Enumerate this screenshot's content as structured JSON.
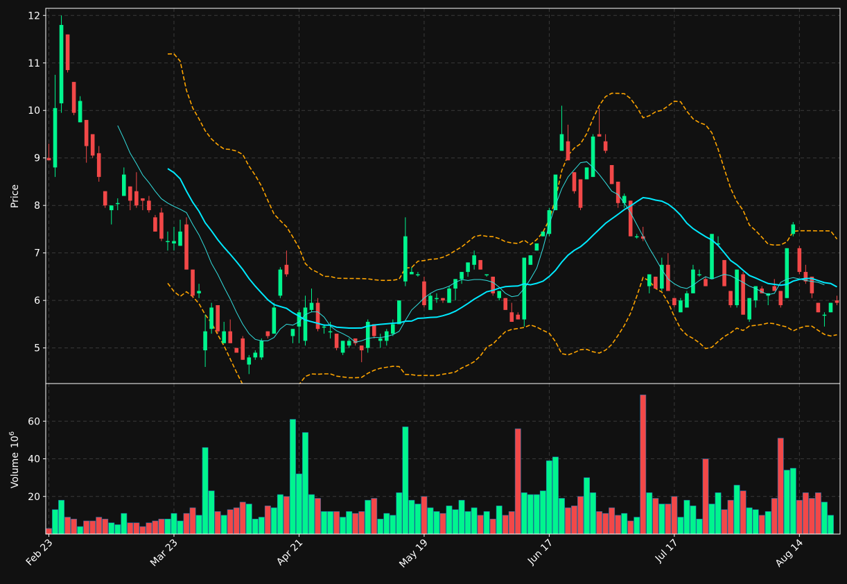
{
  "chart_data": {
    "type": "candlestick",
    "ylabel": "Price",
    "volume_label": "Volume",
    "volume_exponent": "10",
    "volume_exponent_power": "6",
    "price_ylim": [
      4.25,
      12.15
    ],
    "volume_ylim": [
      0,
      80
    ],
    "price_ticks": [
      "5",
      "6",
      "7",
      "8",
      "9",
      "10",
      "11",
      "12"
    ],
    "volume_ticks": [
      "20",
      "40",
      "60"
    ],
    "x_ticks": [
      {
        "index": 0,
        "label": "Feb 23"
      },
      {
        "index": 20,
        "label": "Mar 23"
      },
      {
        "index": 40,
        "label": "Apr 21"
      },
      {
        "index": 60,
        "label": "May 19"
      },
      {
        "index": 80,
        "label": "Jun 17"
      },
      {
        "index": 100,
        "label": "Jul 17"
      },
      {
        "index": 120,
        "label": "Aug 14"
      }
    ],
    "colors": {
      "up": "#00f58e",
      "down": "#f24848",
      "ma_fast": "#32e0e0",
      "ma_slow": "#00eaff",
      "bands": "#ffa500",
      "grid": "#3a3a3a",
      "background": "#111111"
    },
    "ohlc": [
      [
        9.0,
        9.3,
        8.95,
        8.95
      ],
      [
        8.8,
        10.75,
        8.6,
        10.05
      ],
      [
        10.15,
        12.0,
        9.95,
        11.8
      ],
      [
        11.6,
        11.6,
        10.8,
        10.85
      ],
      [
        10.6,
        10.6,
        9.9,
        9.95
      ],
      [
        9.75,
        10.3,
        9.75,
        10.2
      ],
      [
        9.8,
        9.8,
        8.9,
        9.25
      ],
      [
        9.5,
        9.5,
        9.0,
        9.05
      ],
      [
        9.1,
        9.25,
        8.5,
        8.6
      ],
      [
        8.3,
        8.3,
        7.95,
        8.0
      ],
      [
        7.9,
        8.0,
        7.6,
        8.0
      ],
      [
        8.05,
        8.15,
        7.9,
        8.05
      ],
      [
        8.2,
        8.8,
        8.2,
        8.65
      ],
      [
        8.4,
        8.4,
        7.9,
        8.1
      ],
      [
        8.3,
        8.7,
        7.95,
        8.0
      ],
      [
        8.15,
        8.15,
        7.9,
        8.1
      ],
      [
        8.1,
        8.2,
        7.85,
        7.9
      ],
      [
        7.75,
        7.8,
        7.45,
        7.45
      ],
      [
        7.85,
        7.95,
        7.25,
        7.3
      ],
      [
        7.25,
        7.45,
        7.05,
        7.25
      ],
      [
        7.2,
        7.55,
        7.05,
        7.25
      ],
      [
        7.15,
        7.7,
        7.15,
        7.45
      ],
      [
        7.6,
        7.75,
        6.65,
        6.65
      ],
      [
        6.65,
        6.65,
        6.05,
        6.1
      ],
      [
        6.15,
        6.35,
        6.05,
        6.2
      ],
      [
        4.95,
        5.7,
        4.6,
        5.35
      ],
      [
        5.4,
        5.95,
        5.3,
        5.85
      ],
      [
        5.9,
        5.9,
        5.3,
        5.35
      ],
      [
        5.1,
        5.55,
        5.1,
        5.35
      ],
      [
        5.35,
        5.6,
        5.1,
        5.1
      ],
      [
        5.0,
        5.0,
        4.9,
        4.9
      ],
      [
        5.2,
        5.25,
        4.75,
        4.75
      ],
      [
        4.65,
        4.85,
        4.45,
        4.8
      ],
      [
        4.8,
        4.95,
        4.75,
        4.9
      ],
      [
        4.8,
        5.2,
        4.75,
        5.15
      ],
      [
        5.35,
        5.35,
        5.2,
        5.25
      ],
      [
        5.3,
        5.95,
        5.3,
        5.85
      ],
      [
        6.1,
        6.7,
        6.05,
        6.65
      ],
      [
        6.75,
        7.05,
        6.5,
        6.55
      ],
      [
        5.25,
        5.4,
        5.1,
        5.4
      ],
      [
        5.45,
        5.8,
        5.1,
        5.75
      ],
      [
        5.15,
        6.1,
        5.05,
        5.85
      ],
      [
        5.8,
        6.25,
        5.75,
        5.95
      ],
      [
        5.95,
        6.05,
        5.35,
        5.4
      ],
      [
        5.45,
        5.5,
        5.3,
        5.45
      ],
      [
        5.35,
        5.55,
        5.2,
        5.35
      ],
      [
        5.3,
        5.3,
        4.95,
        5.0
      ],
      [
        4.9,
        5.15,
        4.85,
        5.15
      ],
      [
        5.05,
        5.2,
        5.0,
        5.15
      ],
      [
        5.2,
        5.2,
        5.05,
        5.1
      ],
      [
        5.05,
        5.05,
        4.7,
        4.95
      ],
      [
        5.0,
        5.6,
        4.9,
        5.55
      ],
      [
        5.5,
        5.5,
        5.2,
        5.25
      ],
      [
        5.15,
        5.3,
        5.0,
        5.2
      ],
      [
        5.15,
        5.4,
        5.05,
        5.35
      ],
      [
        5.3,
        5.6,
        5.25,
        5.5
      ],
      [
        5.5,
        6.0,
        5.5,
        6.0
      ],
      [
        6.4,
        7.75,
        6.3,
        7.35
      ],
      [
        6.55,
        6.7,
        6.55,
        6.6
      ],
      [
        6.55,
        6.6,
        6.5,
        6.55
      ],
      [
        6.4,
        6.5,
        5.85,
        5.9
      ],
      [
        5.8,
        6.15,
        5.8,
        6.1
      ],
      [
        6.05,
        6.15,
        5.95,
        6.05
      ],
      [
        6.05,
        6.05,
        5.95,
        6.0
      ],
      [
        5.95,
        6.3,
        5.95,
        6.25
      ],
      [
        6.25,
        6.45,
        6.0,
        6.45
      ],
      [
        6.45,
        6.6,
        6.35,
        6.6
      ],
      [
        6.6,
        6.8,
        6.5,
        6.8
      ],
      [
        6.75,
        7.05,
        6.65,
        6.95
      ],
      [
        6.85,
        6.85,
        6.65,
        6.65
      ],
      [
        6.55,
        6.55,
        6.5,
        6.55
      ],
      [
        6.5,
        6.5,
        6.1,
        6.15
      ],
      [
        6.05,
        6.2,
        6.0,
        6.2
      ],
      [
        6.05,
        6.05,
        5.8,
        5.8
      ],
      [
        5.75,
        5.95,
        5.55,
        5.55
      ],
      [
        5.7,
        5.75,
        5.6,
        5.6
      ],
      [
        5.6,
        6.15,
        5.45,
        6.9
      ],
      [
        6.75,
        6.95,
        6.75,
        6.95
      ],
      [
        7.05,
        7.2,
        7.05,
        7.2
      ],
      [
        7.35,
        7.45,
        7.35,
        7.45
      ],
      [
        7.4,
        7.95,
        7.35,
        7.9
      ],
      [
        7.9,
        8.6,
        7.9,
        8.65
      ],
      [
        9.15,
        10.1,
        9.15,
        9.5
      ],
      [
        9.35,
        9.7,
        8.95,
        8.95
      ],
      [
        8.7,
        8.7,
        8.25,
        8.3
      ],
      [
        8.55,
        8.55,
        7.9,
        7.95
      ],
      [
        8.55,
        8.8,
        8.55,
        8.8
      ],
      [
        8.6,
        9.5,
        8.6,
        9.45
      ],
      [
        9.5,
        10.05,
        9.45,
        9.45
      ],
      [
        9.35,
        9.5,
        9.1,
        9.15
      ],
      [
        8.85,
        8.85,
        8.45,
        8.45
      ],
      [
        8.5,
        8.5,
        7.95,
        8.05
      ],
      [
        8.05,
        8.25,
        7.95,
        8.2
      ],
      [
        8.1,
        8.1,
        7.35,
        7.35
      ],
      [
        7.35,
        7.4,
        7.3,
        7.35
      ],
      [
        7.35,
        7.55,
        7.25,
        7.3
      ],
      [
        6.3,
        6.55,
        6.15,
        6.55
      ],
      [
        6.5,
        6.5,
        6.25,
        6.25
      ],
      [
        6.25,
        6.9,
        6.2,
        6.75
      ],
      [
        6.75,
        7.0,
        6.2,
        6.2
      ],
      [
        6.05,
        6.05,
        5.85,
        5.9
      ],
      [
        5.75,
        6.05,
        5.75,
        6.0
      ],
      [
        5.85,
        6.2,
        5.85,
        6.15
      ],
      [
        6.15,
        6.75,
        6.15,
        6.65
      ],
      [
        6.55,
        6.65,
        6.5,
        6.55
      ],
      [
        6.45,
        6.5,
        6.3,
        6.3
      ],
      [
        6.45,
        7.4,
        6.45,
        7.4
      ],
      [
        7.2,
        7.35,
        7.15,
        7.2
      ],
      [
        6.85,
        6.85,
        6.3,
        6.3
      ],
      [
        6.2,
        6.2,
        5.85,
        5.9
      ],
      [
        5.9,
        6.65,
        5.85,
        6.65
      ],
      [
        6.55,
        6.6,
        5.7,
        5.7
      ],
      [
        5.6,
        6.05,
        5.55,
        6.05
      ],
      [
        6.0,
        6.3,
        5.85,
        6.3
      ],
      [
        6.25,
        6.3,
        6.15,
        6.15
      ],
      [
        6.1,
        6.15,
        5.9,
        6.15
      ],
      [
        6.3,
        6.45,
        6.2,
        6.2
      ],
      [
        6.2,
        6.2,
        5.85,
        5.9
      ],
      [
        6.05,
        7.1,
        6.05,
        7.1
      ],
      [
        7.4,
        7.65,
        7.35,
        7.6
      ],
      [
        7.1,
        7.15,
        6.55,
        6.6
      ],
      [
        6.6,
        6.75,
        6.35,
        6.4
      ],
      [
        6.5,
        6.5,
        6.05,
        6.15
      ],
      [
        5.95,
        5.95,
        5.75,
        5.75
      ],
      [
        5.7,
        5.75,
        5.45,
        5.7
      ],
      [
        5.75,
        5.95,
        5.75,
        5.95
      ],
      [
        6.0,
        6.1,
        5.9,
        5.95
      ]
    ],
    "volume": [
      3,
      13,
      18,
      9,
      8,
      4,
      7,
      7,
      9,
      8,
      6,
      5,
      11,
      6,
      6,
      4,
      6,
      7,
      8,
      8,
      11,
      7,
      11,
      14,
      10,
      46,
      23,
      12,
      10,
      13,
      14,
      17,
      16,
      8,
      9,
      15,
      14,
      21,
      20,
      61,
      32,
      54,
      21,
      19,
      12,
      12,
      12,
      9,
      12,
      11,
      12,
      18,
      19,
      8,
      11,
      10,
      22,
      57,
      18,
      16,
      20,
      14,
      12,
      11,
      15,
      13,
      18,
      12,
      14,
      10,
      12,
      8,
      15,
      10,
      12,
      56,
      22,
      21,
      21,
      23,
      39,
      41,
      19,
      14,
      15,
      20,
      30,
      22,
      12,
      11,
      14,
      10,
      11,
      7,
      9,
      74,
      22,
      19,
      16,
      16,
      20,
      9,
      18,
      15,
      8,
      40,
      16,
      22,
      13,
      18,
      26,
      23,
      14,
      13,
      10,
      12,
      19,
      51,
      34,
      35,
      18,
      22,
      19,
      22,
      17,
      10
    ],
    "ma_fast": [
      null,
      null,
      null,
      null,
      null,
      null,
      null,
      null,
      null,
      null,
      null,
      9.68,
      9.4,
      9.1,
      8.88,
      8.64,
      8.48,
      8.3,
      8.14,
      8.05,
      7.98,
      7.92,
      7.85,
      7.6,
      7.38,
      7.1,
      6.78,
      6.55,
      6.28,
      6.03,
      5.75,
      5.5,
      5.3,
      5.18,
      5.15,
      5.15,
      5.22,
      5.4,
      5.5,
      5.48,
      5.55,
      5.7,
      5.76,
      5.76,
      5.65,
      5.46,
      5.36,
      5.3,
      5.23,
      5.12,
      5.15,
      5.2,
      5.22,
      5.22,
      5.24,
      5.28,
      5.35,
      5.58,
      5.8,
      5.92,
      6.05,
      6.15,
      6.22,
      6.25,
      6.3,
      6.38,
      6.44,
      6.42,
      6.44,
      6.44,
      6.42,
      6.38,
      6.28,
      6.15,
      6.08,
      6.1,
      6.25,
      6.45,
      6.68,
      7.1,
      7.6,
      8.0,
      8.35,
      8.6,
      8.75,
      8.9,
      8.92,
      8.8,
      8.65,
      8.48,
      8.3,
      8.23,
      8.05,
      7.85,
      7.6,
      7.35,
      7.1,
      6.88,
      6.65,
      6.45,
      6.35,
      6.28,
      6.25,
      6.32,
      6.42,
      6.5,
      6.45,
      6.5,
      6.55,
      6.52,
      6.45,
      6.38,
      6.3,
      6.25,
      6.18,
      6.12,
      6.15,
      6.38,
      6.45,
      6.48,
      6.45,
      6.42,
      6.4,
      6.38,
      6.33
    ]
  }
}
